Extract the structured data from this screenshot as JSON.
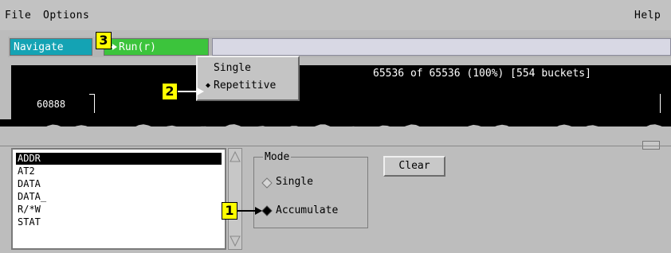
{
  "menubar": {
    "file": "File",
    "options": "Options",
    "help": "Help"
  },
  "toolbar": {
    "navigate": "Navigate",
    "run": "Run(r)"
  },
  "display": {
    "buckets_text": "65536 of 65536 (100%) [554 buckets]",
    "count": "60888"
  },
  "popup": {
    "single": "Single",
    "repetitive": "Repetitive"
  },
  "labels_list": [
    "ADDR",
    "AT2",
    "DATA",
    "DATA_",
    "R/*W",
    "STAT"
  ],
  "mode": {
    "title": "Mode",
    "single": "Single",
    "accumulate": "Accumulate",
    "selected": "Accumulate"
  },
  "clear_button": "Clear",
  "callouts": {
    "c1": "1",
    "c2": "2",
    "c3": "3"
  },
  "colors": {
    "navigate": "#14a3b4",
    "run": "#3cc43c",
    "callout": "#ffff00"
  }
}
